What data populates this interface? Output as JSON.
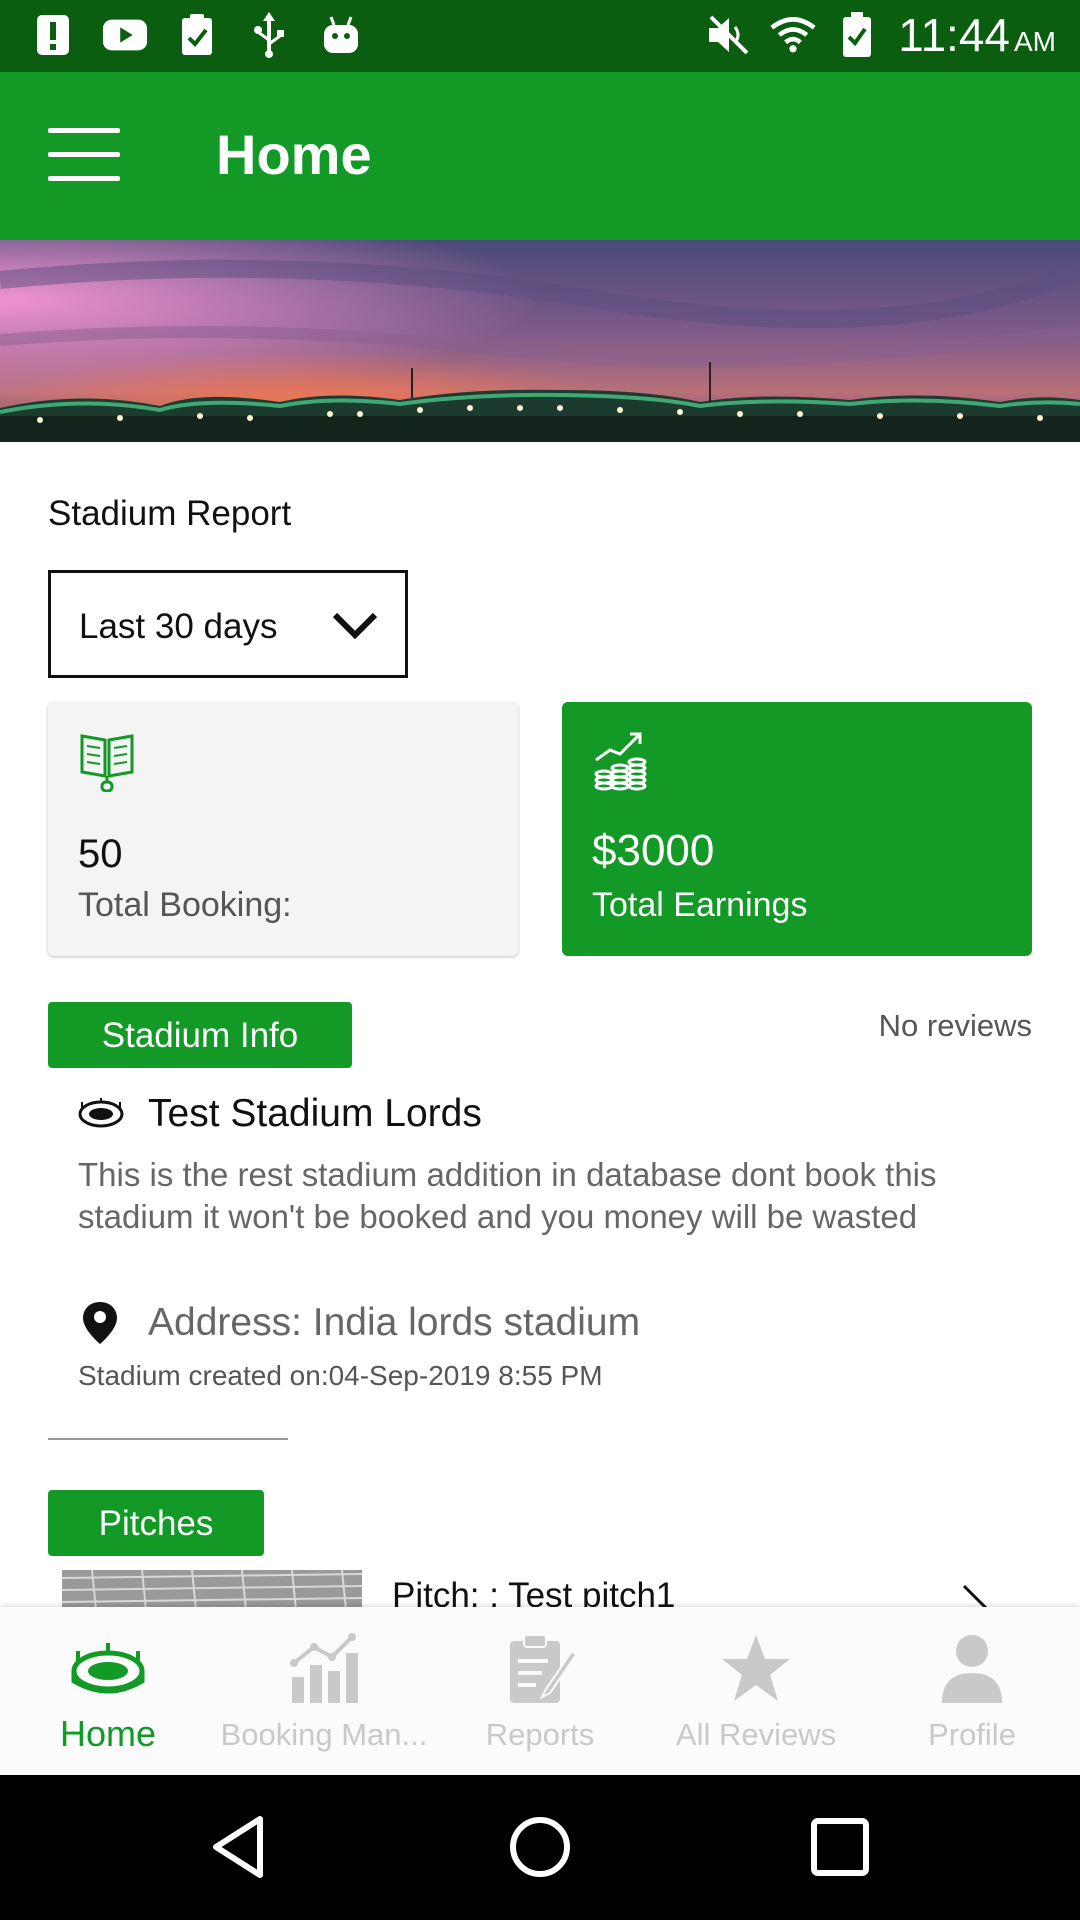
{
  "status_bar": {
    "time": "11:44",
    "ampm": "AM",
    "icons": [
      "alert-icon",
      "youtube-icon",
      "clipboard-check-icon",
      "usb-icon",
      "android-icon",
      "mute-icon",
      "wifi-icon",
      "battery-icon"
    ]
  },
  "app_bar": {
    "title": "Home",
    "menu_icon": "hamburger-menu-icon"
  },
  "colors": {
    "primary": "#129926",
    "status_bar": "#0b5e10",
    "inactive_nav": "#c9c9c9"
  },
  "report": {
    "title": "Stadium Report",
    "period": "Last 30 days",
    "cards": {
      "booking": {
        "value": "50",
        "label": "Total Booking:",
        "icon": "booking-book-icon"
      },
      "earnings": {
        "value": "$3000",
        "label": "Total Earnings",
        "icon": "earnings-coins-icon"
      }
    }
  },
  "stadium": {
    "section_label": "Stadium Info",
    "reviews": "No reviews",
    "name": "Test Stadium Lords",
    "description": "This is the rest stadium addition in database dont book this stadium it won't be booked and you money will be wasted",
    "address": "Address: India lords stadium",
    "created": "Stadium created on:04-Sep-2019 8:55 PM"
  },
  "pitches": {
    "section_label": "Pitches",
    "items": [
      {
        "name": "Pitch: : Test pitch1"
      }
    ]
  },
  "bottom_nav": {
    "items": [
      {
        "label": "Home",
        "icon": "stadium-icon",
        "active": true
      },
      {
        "label": "Booking Man...",
        "icon": "bar-chart-icon",
        "active": false
      },
      {
        "label": "Reports",
        "icon": "report-clipboard-icon",
        "active": false
      },
      {
        "label": "All Reviews",
        "icon": "star-icon",
        "active": false
      },
      {
        "label": "Profile",
        "icon": "person-icon",
        "active": false
      }
    ]
  },
  "system_nav": [
    "back-icon",
    "home-circle-icon",
    "recents-icon"
  ]
}
